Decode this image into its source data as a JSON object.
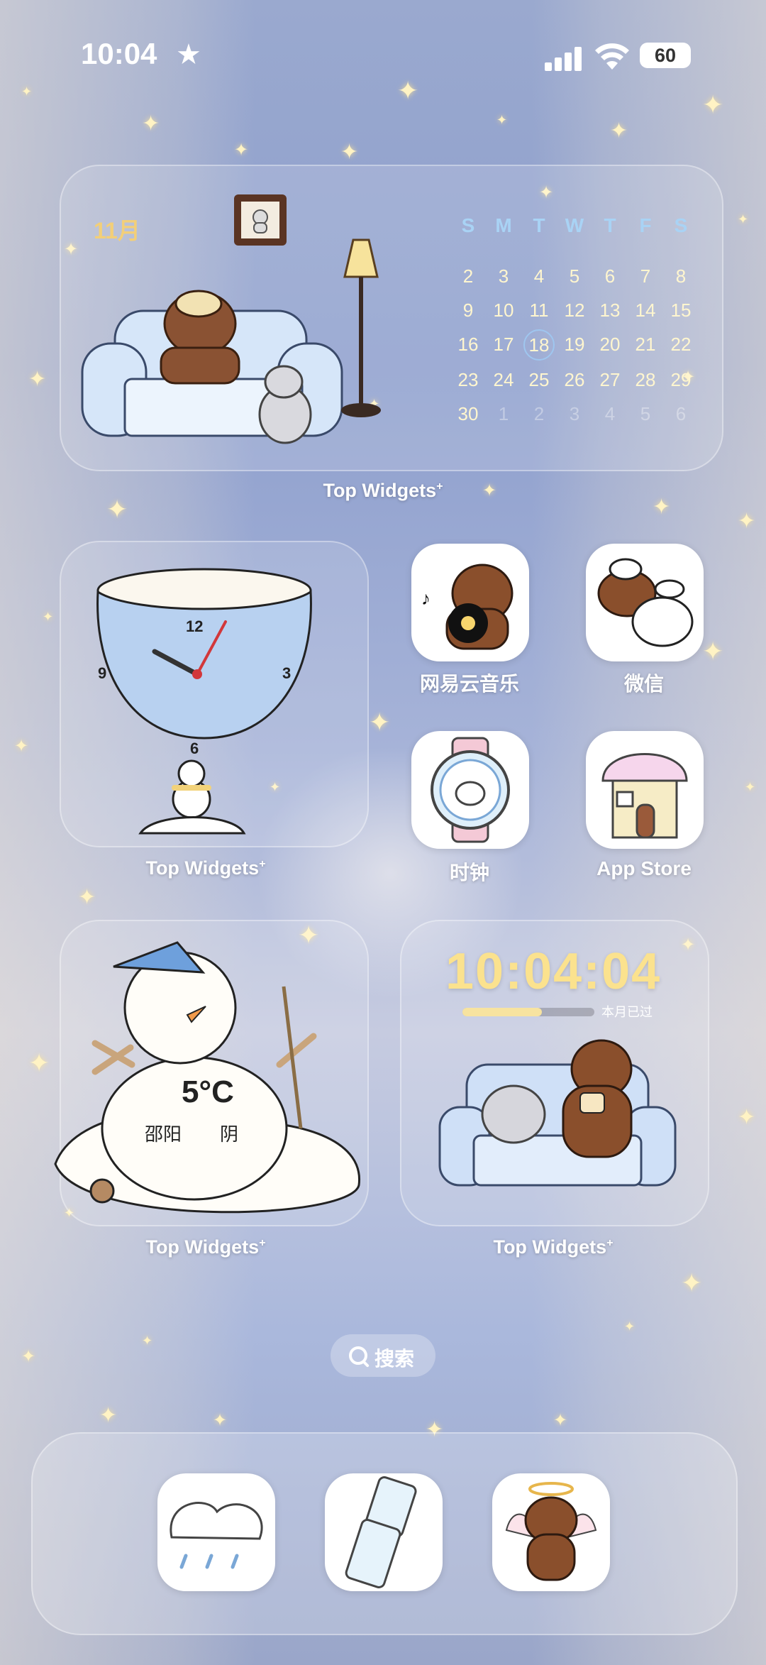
{
  "status_bar": {
    "time": "10:04",
    "battery": "60"
  },
  "calendar_widget": {
    "month": "11月",
    "weekdays": [
      "S",
      "M",
      "T",
      "W",
      "T",
      "F",
      "S"
    ],
    "days": [
      [
        "2",
        "3",
        "4",
        "5",
        "6",
        "7",
        "8"
      ],
      [
        "9",
        "10",
        "11",
        "12",
        "13",
        "14",
        "15"
      ],
      [
        "16",
        "17",
        "18",
        "19",
        "20",
        "21",
        "22"
      ],
      [
        "23",
        "24",
        "25",
        "26",
        "27",
        "28",
        "29"
      ],
      [
        "30",
        "1",
        "2",
        "3",
        "4",
        "5",
        "6"
      ]
    ],
    "today": "18",
    "caption": "Top Widgets"
  },
  "clock_widget": {
    "numerals": [
      "12",
      "3",
      "6",
      "9"
    ],
    "caption": "Top Widgets"
  },
  "apps": {
    "netease_music": "网易云音乐",
    "wechat": "微信",
    "clock": "时钟",
    "app_store": "App Store"
  },
  "weather_widget": {
    "temperature": "5°C",
    "city": "邵阳",
    "condition": "阴",
    "caption": "Top Widgets"
  },
  "digital_clock_widget": {
    "time": "10:04:04",
    "progress": 0.6,
    "progress_label": "本月已过",
    "caption": "Top Widgets"
  },
  "search": {
    "label": "搜索"
  },
  "colors": {
    "accent_yellow": "#fbe28e",
    "weekday_blue": "#a9d3f5"
  }
}
